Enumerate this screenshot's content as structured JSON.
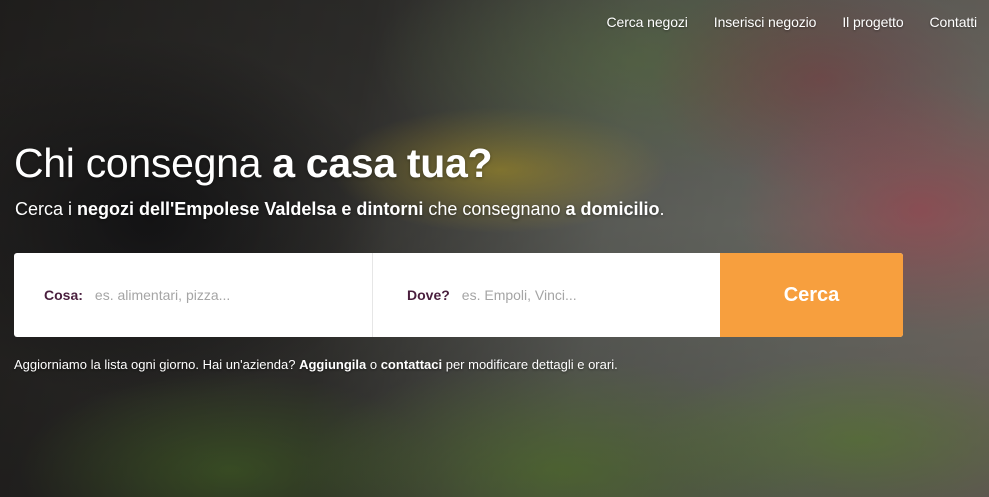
{
  "nav": {
    "items": [
      "Cerca negozi",
      "Inserisci negozio",
      "Il progetto",
      "Contatti"
    ]
  },
  "hero": {
    "title_normal": "Chi consegna ",
    "title_bold": "a casa tua?",
    "subtitle": {
      "p1": "Cerca i ",
      "b1": "negozi dell'Empolese Valdelsa e dintorni",
      "p2": " che consegnano ",
      "b2": "a domicilio",
      "p3": "."
    }
  },
  "search": {
    "cosa_label": "Cosa:",
    "cosa_placeholder": "es. alimentari, pizza...",
    "dove_label": "Dove?",
    "dove_placeholder": "es. Empoli, Vinci...",
    "button_label": "Cerca"
  },
  "note": {
    "p1": "Aggiorniamo la lista ogni giorno. Hai un'azienda? ",
    "link1": "Aggiungila",
    "p2": " o ",
    "link2": "contattaci",
    "p3": " per modificare dettagli e orari."
  },
  "colors": {
    "accent": "#f79f3e",
    "label": "#4a1f3e"
  }
}
